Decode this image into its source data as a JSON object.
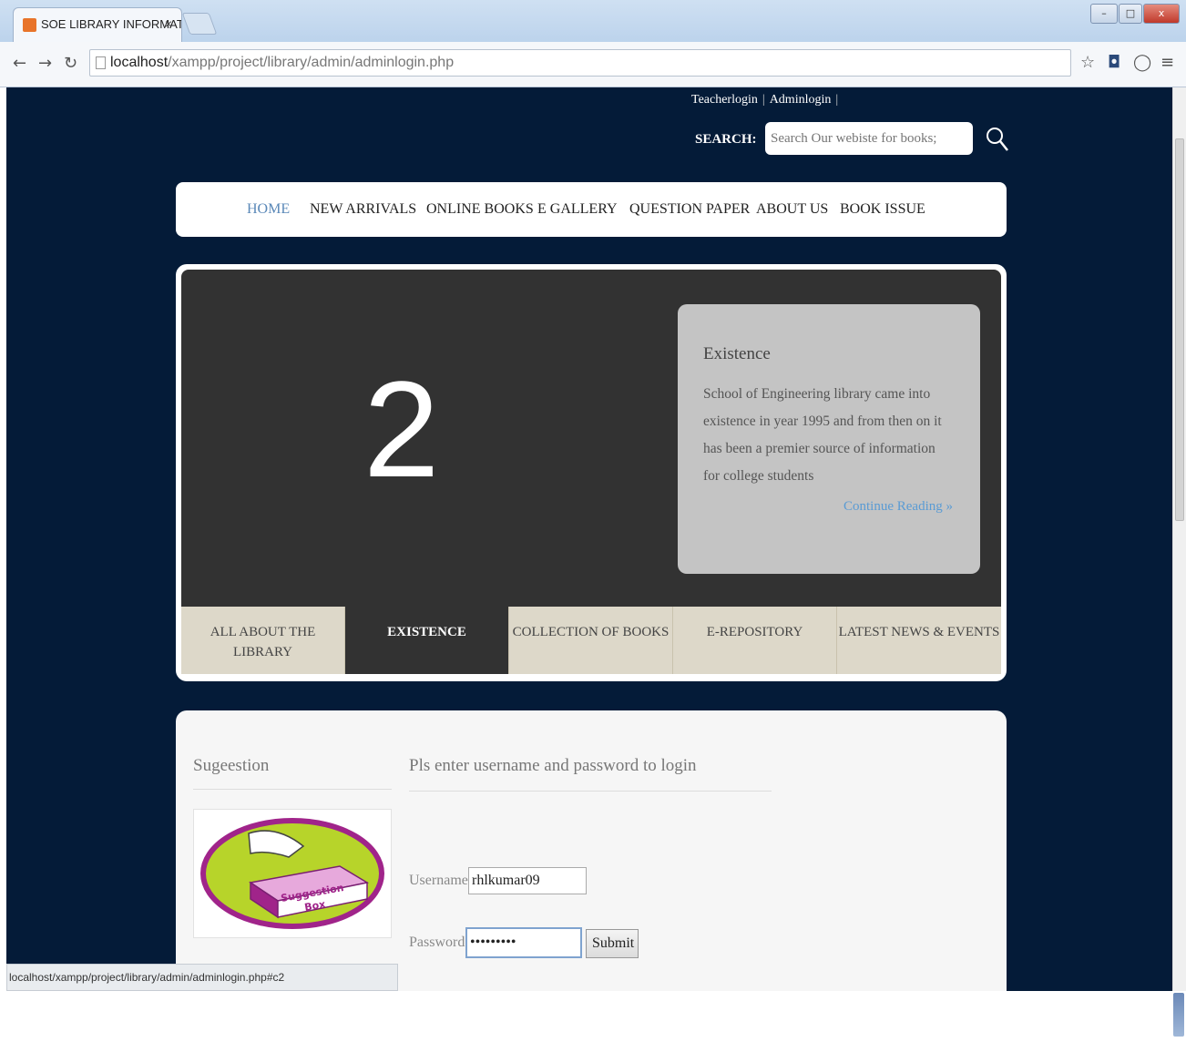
{
  "browser": {
    "tab_title": "SOE LIBRARY INFORMATI",
    "tab_close": "×",
    "url_host": "localhost",
    "url_path": "/xampp/project/library/admin/adminlogin.php",
    "window_buttons": [
      "–",
      "□",
      "x"
    ]
  },
  "header": {
    "links": [
      "Teacherlogin",
      "Adminlogin"
    ],
    "search_label": "SEARCH:",
    "search_placeholder": "Search Our webiste for books;"
  },
  "nav": {
    "items": [
      "HOME",
      "NEW ARRIVALS",
      "ONLINE BOOKS",
      "E GALLERY",
      "QUESTION PAPER",
      "ABOUT US",
      "BOOK ISSUE"
    ],
    "active_index": 0
  },
  "slider": {
    "slide_number": "2",
    "caption_title": "Existence",
    "caption_text": "School of Engineering library came into existence in year 1995 and from then on it has been a premier source of information for college students",
    "continue_link": "Continue Reading »",
    "tabs": [
      "ALL ABOUT THE LIBRARY",
      "EXISTENCE",
      "COLLECTION OF BOOKS",
      "E-REPOSITORY",
      "LATEST NEWS & EVENTS"
    ],
    "active_tab": 1
  },
  "sidebar": {
    "title": "Sugeestion",
    "image_text": "Suggestion Box"
  },
  "login": {
    "title": "Pls enter username and password to login",
    "username_label": "Username:",
    "username_value": "rhlkumar09",
    "password_label": "Password:",
    "password_value": "•••••••••",
    "submit_label": "Submit"
  },
  "status_bar": {
    "url": "localhost/xampp/project/library/admin/adminlogin.php#c2"
  },
  "colors": {
    "page_background": "#041b38",
    "slide_background": "#323232",
    "caption_background": "#c4c4c4",
    "tab_background": "#ddd8c9",
    "nav_active": "#5a88b8",
    "link": "#5a9bd4"
  }
}
